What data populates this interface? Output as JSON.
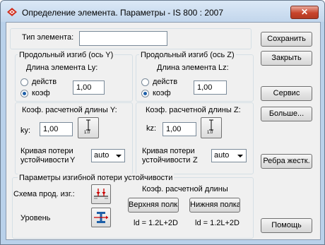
{
  "window": {
    "title": "Определение элемента. Параметры - IS 800 : 2007",
    "close_glyph": "✕"
  },
  "element_type": {
    "label": "Тип элемента:",
    "value": ""
  },
  "buckling_y": {
    "title": "Продольный изгиб (ось Y)",
    "length_label": "Длина элемента Ly:",
    "option_actual": "действ",
    "option_factor": "коэф",
    "selected": "коэф",
    "value": "1,00",
    "coef_label": "Коэф. расчетной длины Y:",
    "k_label": "ky:",
    "k_value": "1,00",
    "k_icon_text": "1.0",
    "curve_label_1": "Кривая потери",
    "curve_label_2": "устойчивости",
    "curve_axis": "Y",
    "curve_value": "auto"
  },
  "buckling_z": {
    "title": "Продольный изгиб (ось Z)",
    "length_label": "Длина элемента Lz:",
    "option_actual": "действ",
    "option_factor": "коэф",
    "selected": "коэф",
    "value": "1,00",
    "coef_label": "Коэф. расчетной длины Z:",
    "k_label": "kz:",
    "k_value": "1,00",
    "k_icon_text": "1.0",
    "curve_label_1": "Кривая потери",
    "curve_label_2": "устойчивости",
    "curve_axis": "Z",
    "curve_value": "auto"
  },
  "lateral": {
    "title": "Параметры изгибной потери устойчивости",
    "scheme_label": "Схема прод. изг.:",
    "level_label": "Уровень",
    "coef_label": "Коэф. расчетной длины",
    "upper_button": "Верхняя полка",
    "lower_button": "Нижняя полка",
    "upper_formula": "ld = 1.2L+2D",
    "lower_formula": "ld = 1.2L+2D"
  },
  "buttons": {
    "save": "Сохранить",
    "close": "Закрыть",
    "service": "Сервис",
    "more": "Больше...",
    "stiffeners": "Ребра жестк.",
    "help": "Помощь"
  },
  "colors": {
    "accent": "#1d5fa8",
    "close_button": "#c8442c",
    "frame": "#b9d1ea"
  }
}
